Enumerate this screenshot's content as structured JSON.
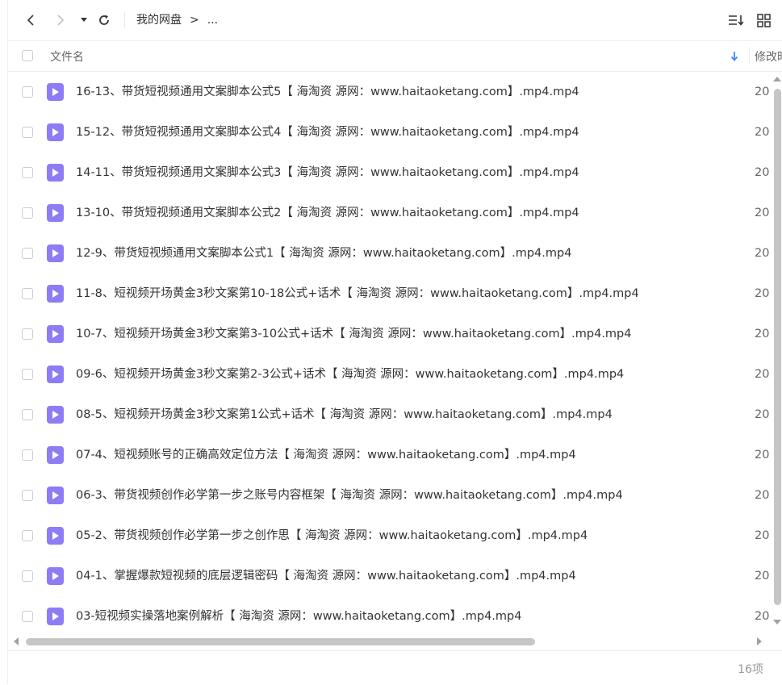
{
  "toolbar": {
    "breadcrumb_root": "我的网盘",
    "breadcrumb_sep": ">",
    "breadcrumb_more": "..."
  },
  "header": {
    "name_label": "文件名",
    "modified_label": "修改时间"
  },
  "files": [
    {
      "name": "16-13、带货短视频通用文案脚本公式5【 海淘资 源网：www.haitaoketang.com】.mp4.mp4",
      "date": "20"
    },
    {
      "name": "15-12、带货短视频通用文案脚本公式4【 海淘资 源网：www.haitaoketang.com】.mp4.mp4",
      "date": "20"
    },
    {
      "name": "14-11、带货短视频通用文案脚本公式3【 海淘资 源网：www.haitaoketang.com】.mp4.mp4",
      "date": "20"
    },
    {
      "name": "13-10、带货短视频通用文案脚本公式2【 海淘资 源网：www.haitaoketang.com】.mp4.mp4",
      "date": "20"
    },
    {
      "name": "12-9、带货短视频通用文案脚本公式1【 海淘资 源网：www.haitaoketang.com】.mp4.mp4",
      "date": "20"
    },
    {
      "name": "11-8、短视频开场黄金3秒文案第10-18公式+话术【 海淘资 源网：www.haitaoketang.com】.mp4.mp4",
      "date": "20"
    },
    {
      "name": "10-7、短视频开场黄金3秒文案第3-10公式+话术【 海淘资 源网：www.haitaoketang.com】.mp4.mp4",
      "date": "20"
    },
    {
      "name": "09-6、短视频开场黄金3秒文案第2-3公式+话术【 海淘资 源网：www.haitaoketang.com】.mp4.mp4",
      "date": "20"
    },
    {
      "name": "08-5、短视频开场黄金3秒文案第1公式+话术【 海淘资 源网：www.haitaoketang.com】.mp4.mp4",
      "date": "20"
    },
    {
      "name": "07-4、短视频账号的正确高效定位方法【 海淘资 源网：www.haitaoketang.com】.mp4.mp4",
      "date": "20"
    },
    {
      "name": "06-3、带货视频创作必学第一步之账号内容框架【 海淘资 源网：www.haitaoketang.com】.mp4.mp4",
      "date": "20"
    },
    {
      "name": "05-2、带货视频创作必学第一步之创作思【 海淘资 源网：www.haitaoketang.com】.mp4.mp4",
      "date": "20"
    },
    {
      "name": "04-1、掌握爆款短视频的底层逻辑密码【 海淘资 源网：www.haitaoketang.com】.mp4.mp4",
      "date": "20"
    },
    {
      "name": "03-短视频实操落地案例解析【 海淘资 源网：www.haitaoketang.com】.mp4.mp4",
      "date": "20"
    }
  ],
  "footer": {
    "count_label": "16项"
  },
  "colors": {
    "file_icon": "#8e7cf4",
    "sort_arrow": "#3b8cf5"
  },
  "icons": [
    "back-icon",
    "forward-icon",
    "dropdown-icon",
    "refresh-icon",
    "sort-icon",
    "grid-view-icon",
    "sort-desc-icon",
    "video-file-icon"
  ]
}
